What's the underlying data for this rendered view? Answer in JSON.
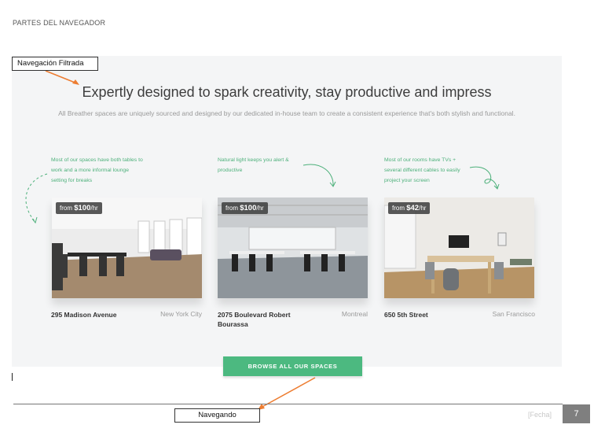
{
  "header": {
    "title": "PARTES DEL NAVEGADOR"
  },
  "hero": {
    "title": "Expertly designed to spark creativity, stay productive and impress",
    "subtitle": "All Breather spaces are uniquely sourced and designed by our dedicated in-house team to create a consistent experience that's both stylish and functional."
  },
  "notes": [
    "Most of our spaces have both tables to work and a more informal lounge setting for breaks",
    "Natural light keeps you alert & productive",
    "Most of our rooms have TVs + several different cables to easily project your screen"
  ],
  "cards": [
    {
      "price_prefix": "from",
      "price": "$100",
      "price_unit": "/hr",
      "address_line1": "295 Madison Avenue",
      "address_line2": "",
      "city": "New York City"
    },
    {
      "price_prefix": "from",
      "price": "$100",
      "price_unit": "/hr",
      "address_line1": "2075 Boulevard Robert",
      "address_line2": "Bourassa",
      "city": "Montreal"
    },
    {
      "price_prefix": "from",
      "price": "$42",
      "price_unit": "/hr",
      "address_line1": "650 5th Street",
      "address_line2": "",
      "city": "San Francisco"
    }
  ],
  "browse_button": {
    "label": "BROWSE ALL OUR SPACES"
  },
  "callouts": {
    "top": "Navegación Filtrada",
    "bottom": "Navegando"
  },
  "footer": {
    "date_placeholder": "[Fecha]",
    "page_number": "7"
  },
  "colors": {
    "accent_green": "#4cb980",
    "arrow_orange": "#ed7d31",
    "panel_bg": "#f4f5f6"
  }
}
